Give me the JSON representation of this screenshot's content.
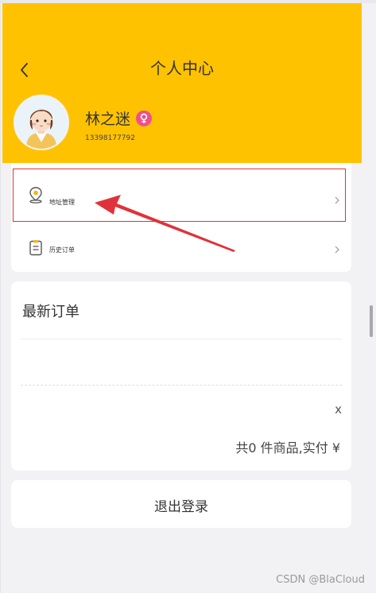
{
  "header": {
    "title": "个人中心",
    "back_icon": "chevron-left-icon",
    "background_color": "#ffc200"
  },
  "profile": {
    "name": "林之迷",
    "phone": "13398177792",
    "gender_icon": "female-icon",
    "gender_color": "#f0508c"
  },
  "menu": {
    "items": [
      {
        "label": "地址管理",
        "icon": "location-pin-icon"
      },
      {
        "label": "历史订单",
        "icon": "clipboard-icon"
      }
    ]
  },
  "orders": {
    "title": "最新订单",
    "close_label": "x",
    "summary": "共0 件商品,实付 ¥"
  },
  "logout": {
    "label": "退出登录"
  },
  "watermark": "CSDN @BlaCloud",
  "annotation_color": "#e0323a"
}
